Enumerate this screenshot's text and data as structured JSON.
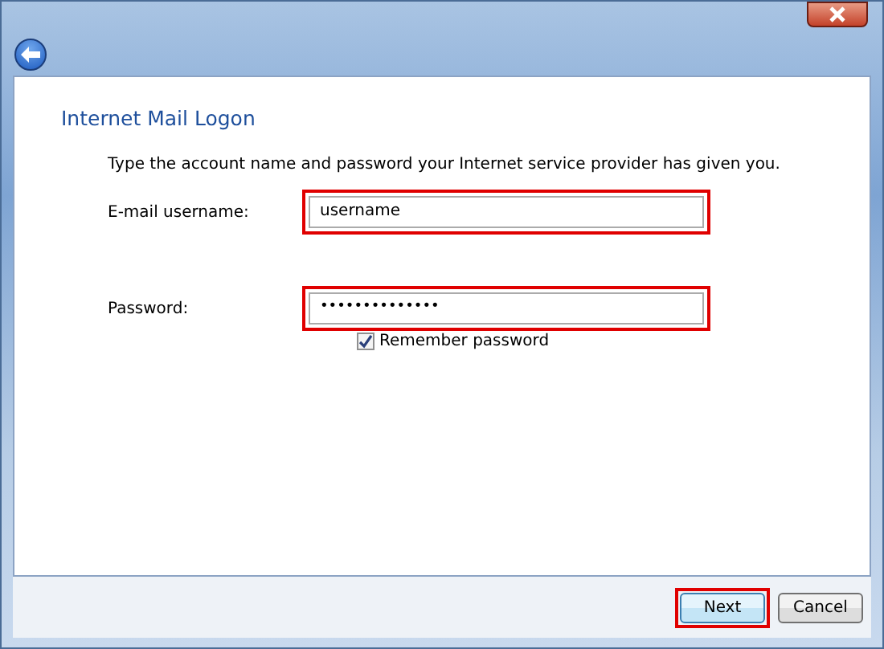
{
  "title": "Internet Mail Logon",
  "instruction": "Type the account name and password your Internet service provider has given you.",
  "fields": [
    {
      "label": "E-mail username:",
      "value": "username",
      "kind": "text",
      "highlighted": true
    },
    {
      "label": "Password:",
      "value": "••••••••••••••",
      "kind": "password",
      "highlighted": true
    }
  ],
  "remember": {
    "label": "Remember password",
    "checked": true
  },
  "buttons": [
    {
      "label": "Next",
      "highlighted": true,
      "default": true
    },
    {
      "label": "Cancel",
      "highlighted": false,
      "default": false
    }
  ]
}
